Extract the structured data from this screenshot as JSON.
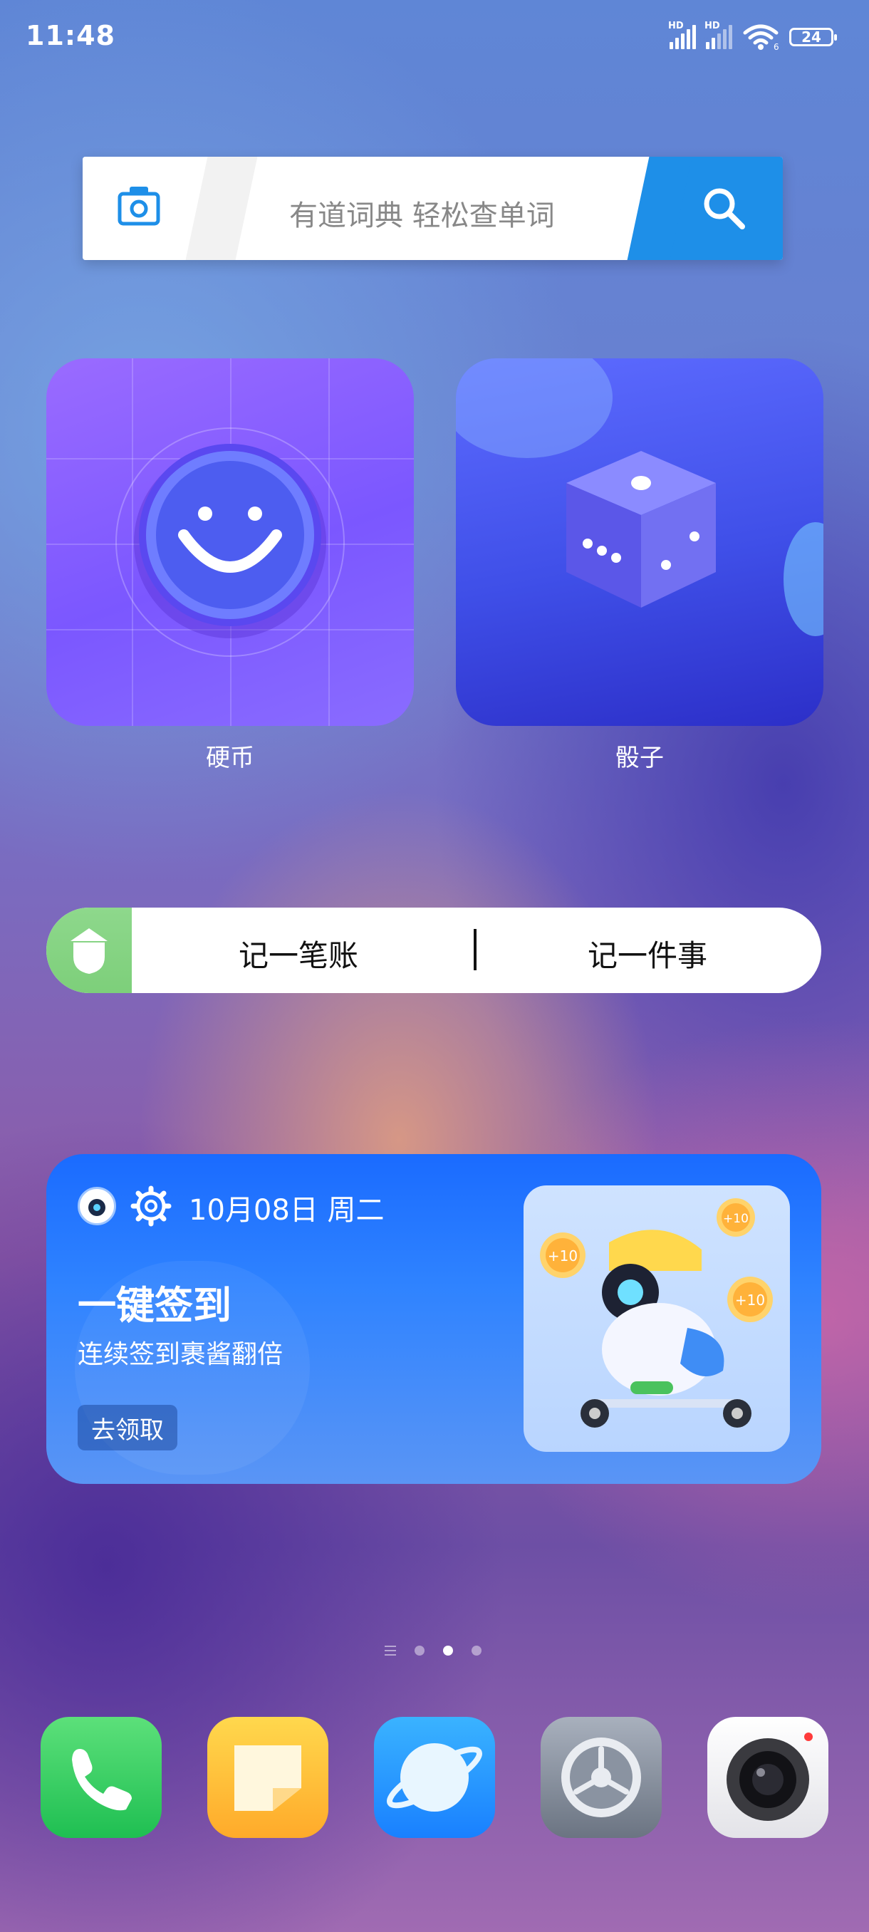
{
  "status_bar": {
    "time": "11:48",
    "sim1_label": "HD",
    "sim2_label": "HD",
    "wifi_label": "6",
    "battery": "24"
  },
  "search_widget": {
    "placeholder": "有道词典 轻松查单词",
    "camera_icon": "camera-icon",
    "search_icon": "search-icon",
    "accent_color": "#1e8fe8"
  },
  "apps": [
    {
      "label": "硬币",
      "icon": "smiley-coin-icon"
    },
    {
      "label": "骰子",
      "icon": "dice-icon"
    }
  ],
  "memo_widget": {
    "icon": "acorn-icon",
    "action1": "记一笔账",
    "action2": "记一件事"
  },
  "signin_card": {
    "date": "10月08日 周二",
    "title": "一键签到",
    "subtitle": "连续签到裹酱翻倍",
    "button": "去领取",
    "coin_badges": [
      "+10",
      "+10",
      "+10"
    ]
  },
  "page_indicator": {
    "pages": 3,
    "active": 2
  },
  "dock": [
    {
      "name": "phone",
      "icon": "phone-icon"
    },
    {
      "name": "notes",
      "icon": "notes-icon"
    },
    {
      "name": "browser",
      "icon": "planet-icon"
    },
    {
      "name": "settings",
      "icon": "gear-icon"
    },
    {
      "name": "camera",
      "icon": "camera-lens-icon"
    }
  ]
}
